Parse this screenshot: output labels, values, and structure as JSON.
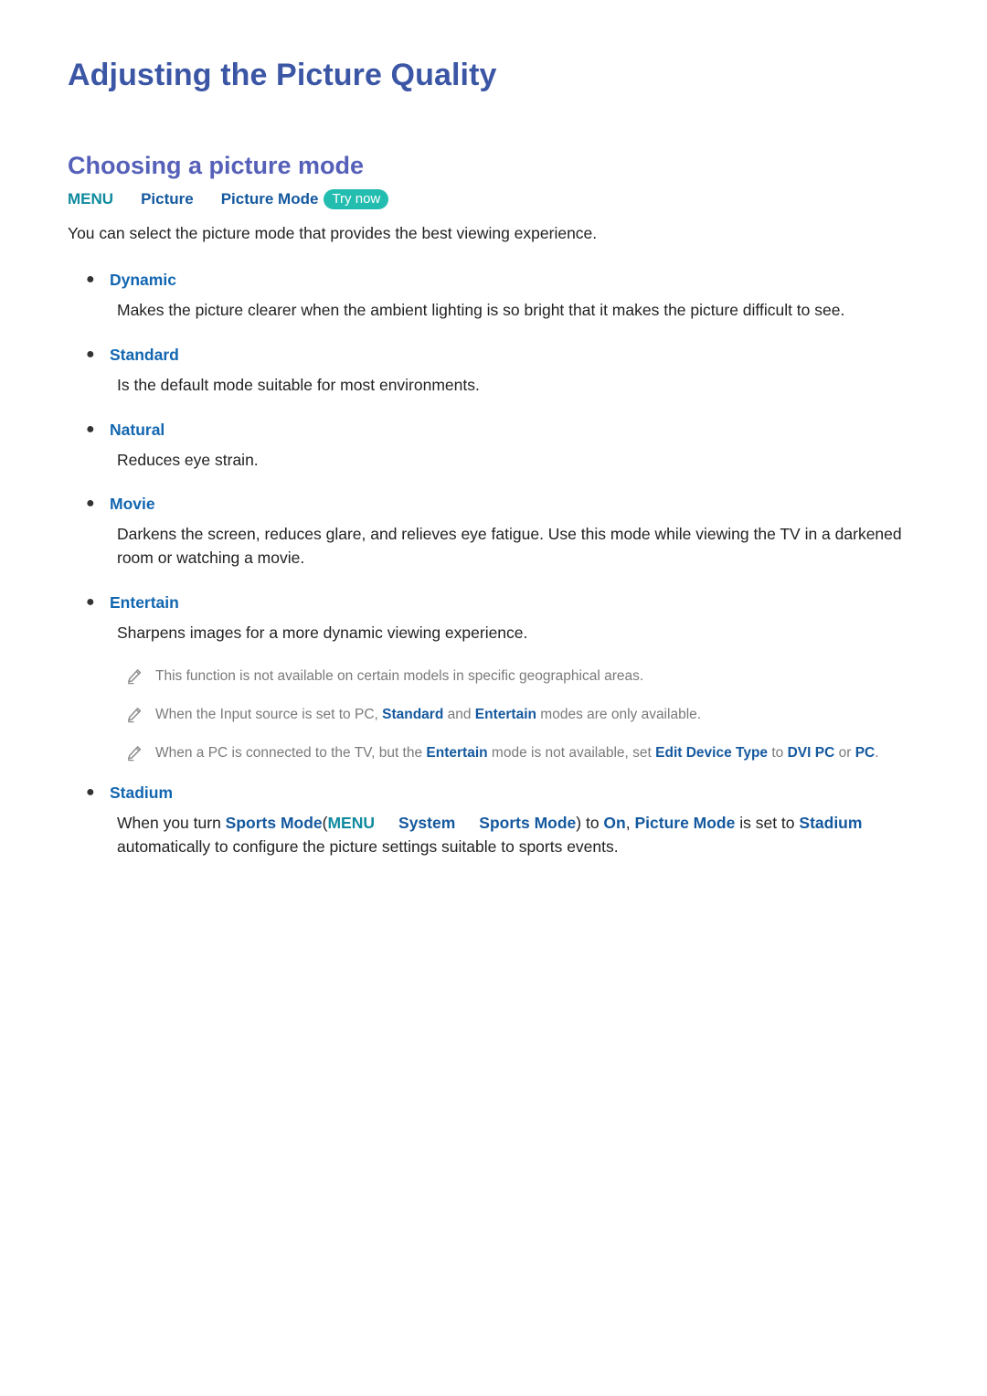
{
  "document": {
    "title": "Adjusting the Picture Quality",
    "section_title": "Choosing a picture mode",
    "intro": "You can select the picture mode that provides the best viewing experience."
  },
  "menu_path": {
    "root": "MENU",
    "step1": "Picture",
    "step2": "Picture Mode",
    "try_now": "Try now",
    "badge_color": "#23bdb0",
    "root_color": "#0f8a9e",
    "step_color": "#14589e"
  },
  "modes": [
    {
      "label": "Dynamic",
      "description": "Makes the picture clearer when the ambient lighting is so bright that it makes the picture difficult to see."
    },
    {
      "label": "Standard",
      "description": "Is the default mode suitable for most environments."
    },
    {
      "label": "Natural",
      "description": "Reduces eye strain."
    },
    {
      "label": "Movie",
      "description": "Darkens the screen, reduces glare, and relieves eye fatigue. Use this mode while viewing the TV in a darkened room or watching a movie."
    },
    {
      "label": "Entertain",
      "description": "Sharpens images for a more dynamic viewing experience."
    }
  ],
  "notes": [
    {
      "parts": [
        {
          "text": "This function is not available on certain models in specific geographical areas.",
          "style": "plain"
        }
      ]
    },
    {
      "parts": [
        {
          "text": "When the Input source is set to PC, ",
          "style": "plain"
        },
        {
          "text": "Standard",
          "style": "keyword"
        },
        {
          "text": " and ",
          "style": "plain"
        },
        {
          "text": "Entertain",
          "style": "keyword"
        },
        {
          "text": " modes are only available.",
          "style": "plain"
        }
      ]
    },
    {
      "parts": [
        {
          "text": "When a PC is connected to the TV, but the ",
          "style": "plain"
        },
        {
          "text": "Entertain",
          "style": "keyword"
        },
        {
          "text": " mode is not available, set ",
          "style": "plain"
        },
        {
          "text": "Edit Device Type",
          "style": "keyword"
        },
        {
          "text": " to ",
          "style": "plain"
        },
        {
          "text": "DVI PC",
          "style": "keyword"
        },
        {
          "text": " or ",
          "style": "plain"
        },
        {
          "text": "PC",
          "style": "keyword"
        },
        {
          "text": ".",
          "style": "plain"
        }
      ]
    }
  ],
  "stadium": {
    "label": "Stadium",
    "text": {
      "p1": "When you turn ",
      "sports_mode": "Sports Mode",
      "open_paren": "(",
      "menu": "MENU",
      "system": "System",
      "sports_mode_menu": "Sports Mode",
      "close_paren": ")",
      "p2": " to ",
      "on": "On",
      "comma": ", ",
      "picture_mode": "Picture Mode",
      "p3": " is set to ",
      "stadium_kw": "Stadium",
      "p4": " automatically to configure the picture settings suitable to sports events."
    }
  },
  "icons": {
    "note": "pencil-icon",
    "bullet": "bullet-dot"
  }
}
